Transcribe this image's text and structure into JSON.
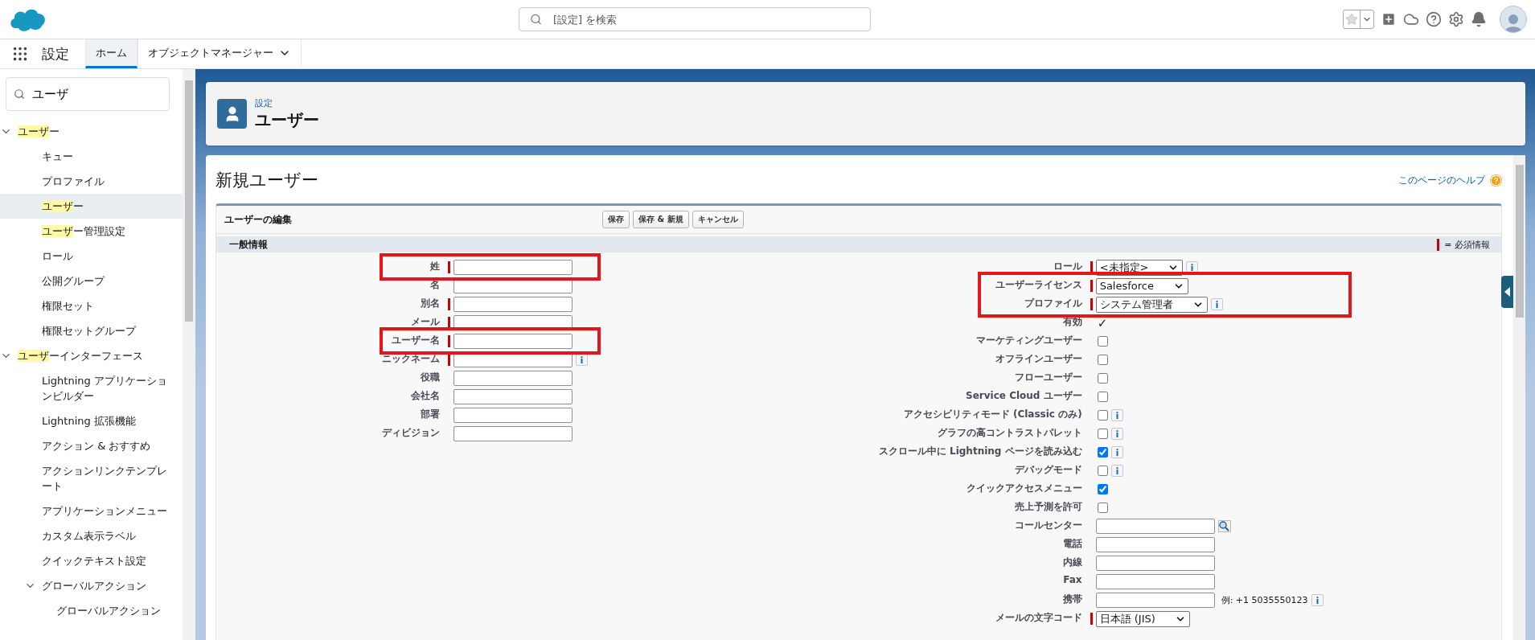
{
  "header": {
    "search": {
      "placeholder": "[設定] を検索"
    }
  },
  "nav": {
    "app_name": "設定",
    "tabs": [
      {
        "label": "ホーム",
        "selected": true,
        "menu": false
      },
      {
        "label": "オブジェクトマネージャー",
        "selected": false,
        "menu": true
      }
    ]
  },
  "sidebar": {
    "search": {
      "value": "ユーザ"
    },
    "tree": [
      {
        "match": "ユーザ",
        "label": "ー",
        "expanded": true,
        "selected": false,
        "children": [
          {
            "label": "キュー",
            "selected": false
          },
          {
            "label": "プロファイル",
            "selected": false
          },
          {
            "match": "ユーザ",
            "label": "ー",
            "selected": true
          },
          {
            "match": "ユーザ",
            "label": "ー管理設定",
            "selected": false
          },
          {
            "label": "ロール",
            "selected": false
          },
          {
            "label": "公開グループ",
            "selected": false
          },
          {
            "label": "権限セット",
            "selected": false
          },
          {
            "label": "権限セットグループ",
            "selected": false
          }
        ]
      },
      {
        "match": "ユーザ",
        "label": "ーインターフェース",
        "expanded": true,
        "selected": false,
        "children": [
          {
            "label": "Lightning アプリケーションビルダー",
            "selected": false
          },
          {
            "label": "Lightning 拡張機能",
            "selected": false
          },
          {
            "label": "アクション & おすすめ",
            "selected": false
          },
          {
            "label": "アクションリンクテンプレート",
            "selected": false
          },
          {
            "label": "アプリケーションメニュー",
            "selected": false
          },
          {
            "label": "カスタム表示ラベル",
            "selected": false
          },
          {
            "label": "クイックテキスト設定",
            "selected": false
          },
          {
            "label": "グローバルアクション",
            "expanded": true,
            "selected": false,
            "children": [
              {
                "label": "グローバルアクション",
                "selected": false
              }
            ]
          }
        ]
      }
    ]
  },
  "page_header": {
    "breadcrumb": "設定",
    "title": "ユーザー"
  },
  "form": {
    "title": "新規ユーザー",
    "help_link": "このページのヘルプ",
    "block_title": "ユーザーの編集",
    "buttons": [
      "保存",
      "保存 & 新規",
      "キャンセル"
    ],
    "section": "一般情報",
    "required_legend": "= 必須情報",
    "left": [
      {
        "label": "姓",
        "kind": "text",
        "required": true,
        "framed": true
      },
      {
        "label": "名",
        "kind": "text",
        "required": false,
        "framed": false
      },
      {
        "label": "別名",
        "kind": "text",
        "required": true,
        "framed": false
      },
      {
        "label": "メール",
        "kind": "text",
        "required": true,
        "framed": false
      },
      {
        "label": "ユーザー名",
        "kind": "text",
        "required": true,
        "framed": true
      },
      {
        "label": "ニックネーム",
        "kind": "text",
        "required": true,
        "framed": false,
        "info": true
      },
      {
        "label": "役職",
        "kind": "text",
        "required": false,
        "framed": false
      },
      {
        "label": "会社名",
        "kind": "text",
        "required": false,
        "framed": false
      },
      {
        "label": "部署",
        "kind": "text",
        "required": false,
        "framed": false
      },
      {
        "label": "ディビジョン",
        "kind": "text",
        "required": false,
        "framed": false
      }
    ],
    "right": [
      {
        "label": "ロール",
        "kind": "select",
        "value": "<未指定>",
        "required": true,
        "framed": false,
        "info": true
      },
      {
        "label": "ユーザーライセンス",
        "kind": "select",
        "value": "Salesforce",
        "required": true,
        "framed": true
      },
      {
        "label": "プロファイル",
        "kind": "select",
        "value": "システム管理者",
        "required": true,
        "framed": true,
        "info": true
      },
      {
        "label": "有効",
        "kind": "tick",
        "mark": "✓",
        "required": false,
        "framed": false
      },
      {
        "label": "マーケティングユーザー",
        "kind": "checkbox",
        "checked": false,
        "required": false,
        "framed": false
      },
      {
        "label": "オフラインユーザー",
        "kind": "checkbox",
        "checked": false,
        "required": false,
        "framed": false
      },
      {
        "label": "フローユーザー",
        "kind": "checkbox",
        "checked": false,
        "required": false,
        "framed": false
      },
      {
        "label": "Service Cloud ユーザー",
        "kind": "checkbox",
        "checked": false,
        "required": false,
        "framed": false
      },
      {
        "label": "アクセシビリティモード (Classic のみ)",
        "kind": "checkbox",
        "checked": false,
        "required": false,
        "framed": false,
        "info": true
      },
      {
        "label": "グラフの高コントラストパレット",
        "kind": "checkbox",
        "checked": false,
        "required": false,
        "framed": false,
        "info": true
      },
      {
        "label": "スクロール中に Lightning ページを読み込む",
        "kind": "checkbox",
        "checked": true,
        "required": false,
        "framed": false,
        "info": true
      },
      {
        "label": "デバッグモード",
        "kind": "checkbox",
        "checked": false,
        "required": false,
        "framed": false,
        "info": true
      },
      {
        "label": "クイックアクセスメニュー",
        "kind": "checkbox",
        "checked": true,
        "required": false,
        "framed": false
      },
      {
        "label": "売上予測を許可",
        "kind": "checkbox",
        "checked": false,
        "required": false,
        "framed": false
      },
      {
        "label": "コールセンター",
        "kind": "lookup",
        "required": false,
        "framed": false
      },
      {
        "label": "電話",
        "kind": "text",
        "required": false,
        "framed": false
      },
      {
        "label": "内線",
        "kind": "text",
        "required": false,
        "framed": false
      },
      {
        "label": "Fax",
        "kind": "text",
        "required": false,
        "framed": false
      },
      {
        "label": "携帯",
        "kind": "text",
        "required": false,
        "framed": false,
        "hint": "例: +1 5035550123",
        "info": true
      },
      {
        "label": "メールの文字コード",
        "kind": "select",
        "value": "日本語 (JIS)",
        "required": true,
        "framed": false
      }
    ]
  }
}
